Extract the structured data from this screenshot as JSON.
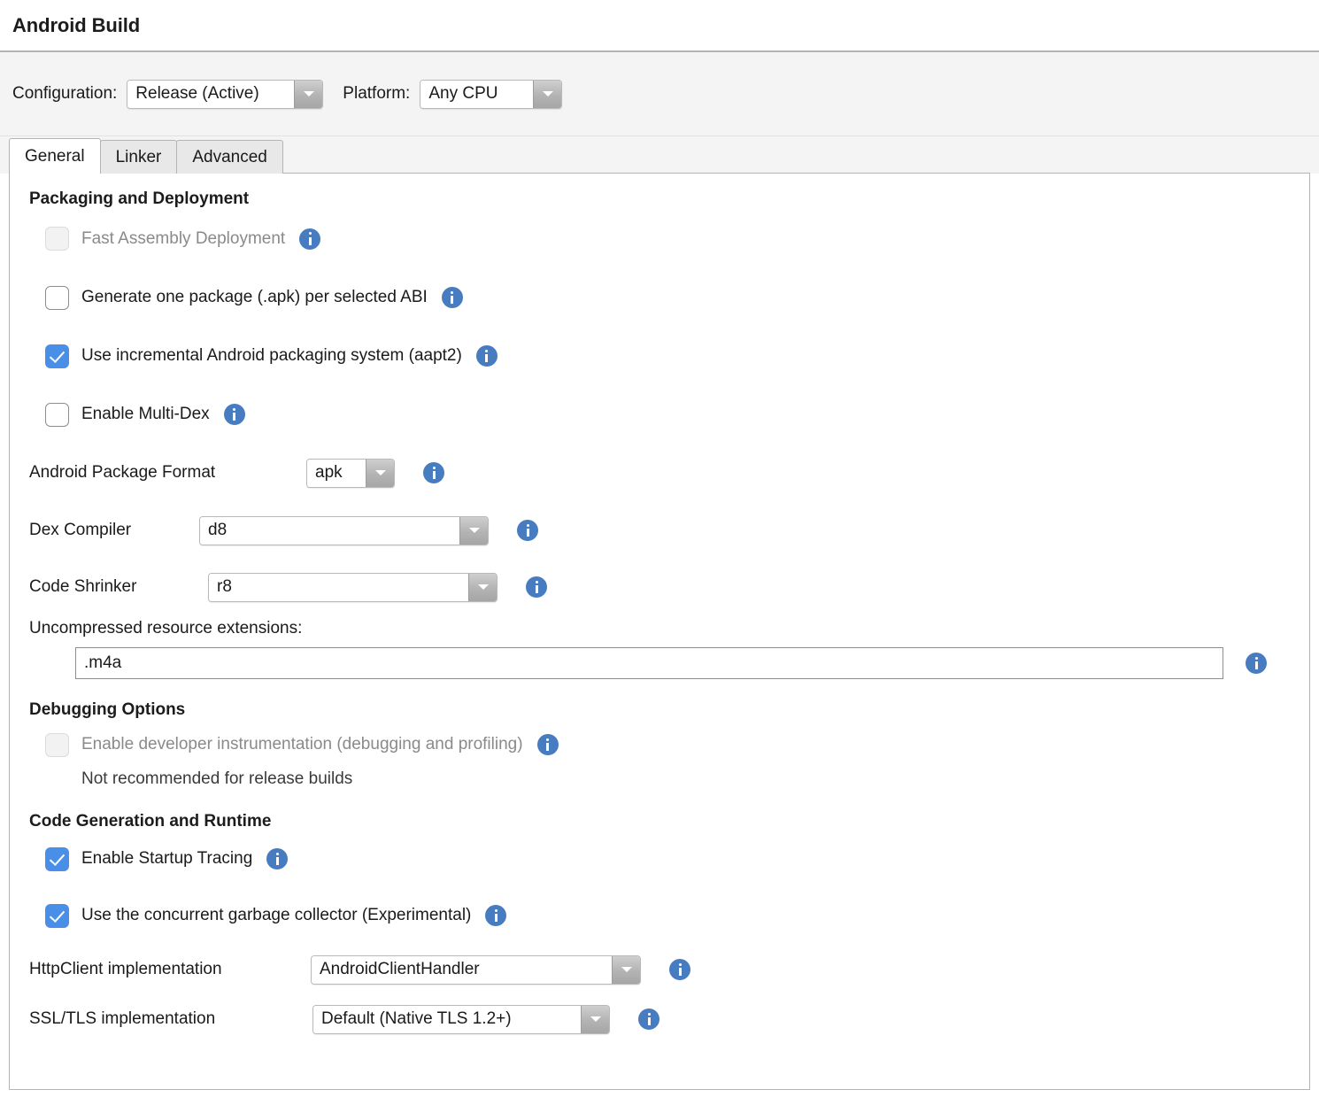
{
  "header": {
    "title": "Android Build"
  },
  "config_bar": {
    "configuration_label": "Configuration:",
    "configuration_value": "Release (Active)",
    "platform_label": "Platform:",
    "platform_value": "Any CPU"
  },
  "tabs": [
    {
      "label": "General",
      "active": true
    },
    {
      "label": "Linker",
      "active": false
    },
    {
      "label": "Advanced",
      "active": false
    }
  ],
  "sections": {
    "packaging": {
      "title": "Packaging and Deployment",
      "checkboxes": [
        {
          "label": "Fast Assembly Deployment",
          "state": "disabled",
          "info": true
        },
        {
          "label": "Generate one package (.apk) per selected ABI",
          "state": "unchecked",
          "info": true
        },
        {
          "label": "Use incremental Android packaging system (aapt2)",
          "state": "checked",
          "info": true
        },
        {
          "label": "Enable Multi-Dex",
          "state": "unchecked",
          "info": true
        }
      ],
      "package_format_label": "Android Package Format",
      "package_format_value": "apk",
      "dex_compiler_label": "Dex Compiler",
      "dex_compiler_value": "d8",
      "code_shrinker_label": "Code Shrinker",
      "code_shrinker_value": "r8",
      "uncompressed_label": "Uncompressed resource extensions:",
      "uncompressed_value": ".m4a"
    },
    "debugging": {
      "title": "Debugging Options",
      "developer_instrumentation_label": "Enable developer instrumentation (debugging and profiling)",
      "developer_instrumentation_state": "disabled",
      "note": "Not recommended for release builds"
    },
    "codegen": {
      "title": "Code Generation and Runtime",
      "startup_tracing_label": "Enable Startup Tracing",
      "startup_tracing_state": "checked",
      "concurrent_gc_label": "Use the concurrent garbage collector (Experimental)",
      "concurrent_gc_state": "checked",
      "httpclient_label": "HttpClient implementation",
      "httpclient_value": "AndroidClientHandler",
      "ssltls_label": "SSL/TLS implementation",
      "ssltls_value": "Default (Native TLS 1.2+)"
    }
  },
  "colors": {
    "accent_blue": "#4a8fe7",
    "info_blue": "#477cc0",
    "panel_bg": "#f4f4f4",
    "border": "#b4b4b4"
  },
  "icons": {
    "info": "info-icon",
    "dropdown_arrow": "chevron-down-icon",
    "checkmark": "check-icon"
  }
}
